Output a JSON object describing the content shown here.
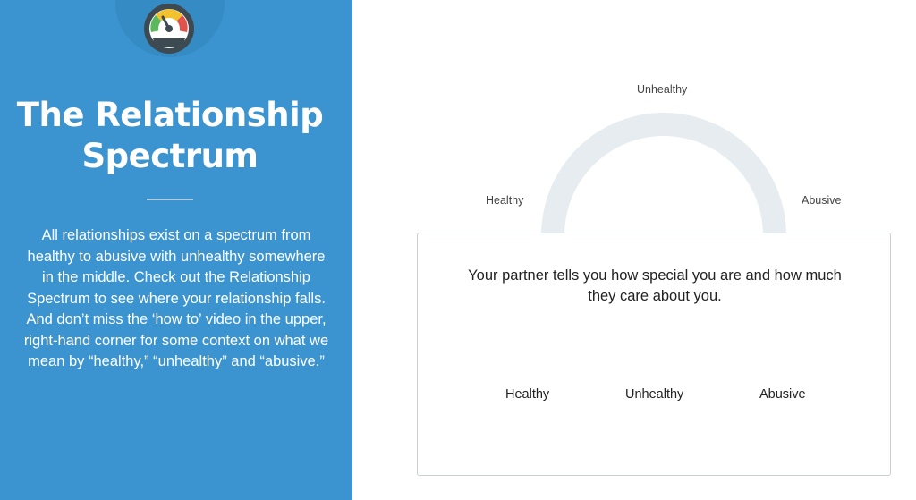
{
  "left_panel": {
    "icon": "speedometer-gauge-icon",
    "title": "The Relationship Spectrum",
    "description": "All relationships exist on a spectrum from healthy to abusive with unhealthy somewhere in the middle. Check out the Relationship Spectrum to see where your relationship falls. And don’t miss the ‘how to’ video in the upper, right-hand corner for some context on what we mean by “healthy,” “unhealthy” and “abusive.”",
    "background_color": "#3b94cf"
  },
  "spectrum": {
    "labels": {
      "healthy": "Healthy",
      "unhealthy": "Unhealthy",
      "abusive": "Abusive"
    },
    "arc_color": "#e6ecef"
  },
  "card": {
    "statement": "Your partner tells you how special you are and how much they care about you.",
    "choices": {
      "healthy": "Healthy",
      "unhealthy": "Unhealthy",
      "abusive": "Abusive"
    }
  },
  "gauge_colors": {
    "green": "#5cb85c",
    "yellow": "#f2c12e",
    "red": "#e0524b",
    "dark": "#3d4a52"
  }
}
